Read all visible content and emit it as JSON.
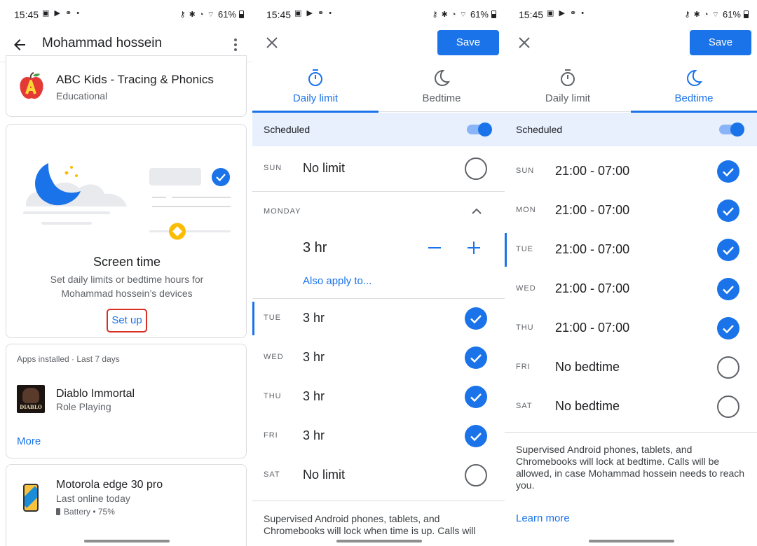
{
  "status_bar": {
    "time": "15:45",
    "battery": "61%",
    "signal_text": "Vo) LTE1 .ıl"
  },
  "profile": {
    "header_title": "Mohammad hossein",
    "top_app": {
      "name": "ABC Kids - Tracing & Phonics",
      "category": "Educational"
    },
    "screen_time_card": {
      "title": "Screen time",
      "description": "Set daily limits or bedtime hours for Mohammad hossein’s devices",
      "setup_label": "Set up"
    },
    "apps_installed": {
      "heading": "Apps installed · Last 7 days",
      "app_name": "Diablo Immortal",
      "app_category": "Role Playing",
      "app_icon_text": "DIABLO",
      "more_label": "More"
    },
    "device": {
      "name": "Motorola edge 30 pro",
      "status": "Last online today",
      "battery": "Battery • 75%"
    }
  },
  "daily_limit_screen": {
    "save_label": "Save",
    "tabs": [
      {
        "label": "Daily limit",
        "icon": "timer-icon",
        "active": true
      },
      {
        "label": "Bedtime",
        "icon": "moon-icon",
        "active": false
      }
    ],
    "scheduled_label": "Scheduled",
    "scheduled_on": true,
    "sun": {
      "day": "SUN",
      "value": "No limit",
      "checked": false
    },
    "monday": {
      "day": "MONDAY",
      "value": "3 hr",
      "also_apply": "Also apply to..."
    },
    "rows": [
      {
        "day": "TUE",
        "value": "3 hr",
        "checked": true
      },
      {
        "day": "WED",
        "value": "3 hr",
        "checked": true
      },
      {
        "day": "THU",
        "value": "3 hr",
        "checked": true
      },
      {
        "day": "FRI",
        "value": "3 hr",
        "checked": true
      },
      {
        "day": "SAT",
        "value": "No limit",
        "checked": false
      }
    ],
    "footnote": "Supervised Android phones, tablets, and Chromebooks will lock when time is up. Calls will"
  },
  "bedtime_screen": {
    "save_label": "Save",
    "tabs": [
      {
        "label": "Daily limit",
        "icon": "timer-icon",
        "active": false
      },
      {
        "label": "Bedtime",
        "icon": "moon-icon",
        "active": true
      }
    ],
    "scheduled_label": "Scheduled",
    "scheduled_on": true,
    "rows": [
      {
        "day": "SUN",
        "value": "21:00 - 07:00",
        "checked": true
      },
      {
        "day": "MON",
        "value": "21:00 - 07:00",
        "checked": true
      },
      {
        "day": "TUE",
        "value": "21:00 - 07:00",
        "checked": true
      },
      {
        "day": "WED",
        "value": "21:00 - 07:00",
        "checked": true
      },
      {
        "day": "THU",
        "value": "21:00 - 07:00",
        "checked": true
      },
      {
        "day": "FRI",
        "value": "No bedtime",
        "checked": false
      },
      {
        "day": "SAT",
        "value": "No bedtime",
        "checked": false
      }
    ],
    "footnote": "Supervised Android phones, tablets, and Chromebooks will lock at bedtime. Calls will be allowed, in case Mohammad hossein needs to reach you.",
    "learn_more": "Learn more"
  },
  "colors": {
    "accent": "#1a73e8",
    "scheduled_bg": "#e8f0fe",
    "highlight_border": "#d93025",
    "text_primary": "#202124",
    "text_secondary": "#5f6368"
  }
}
